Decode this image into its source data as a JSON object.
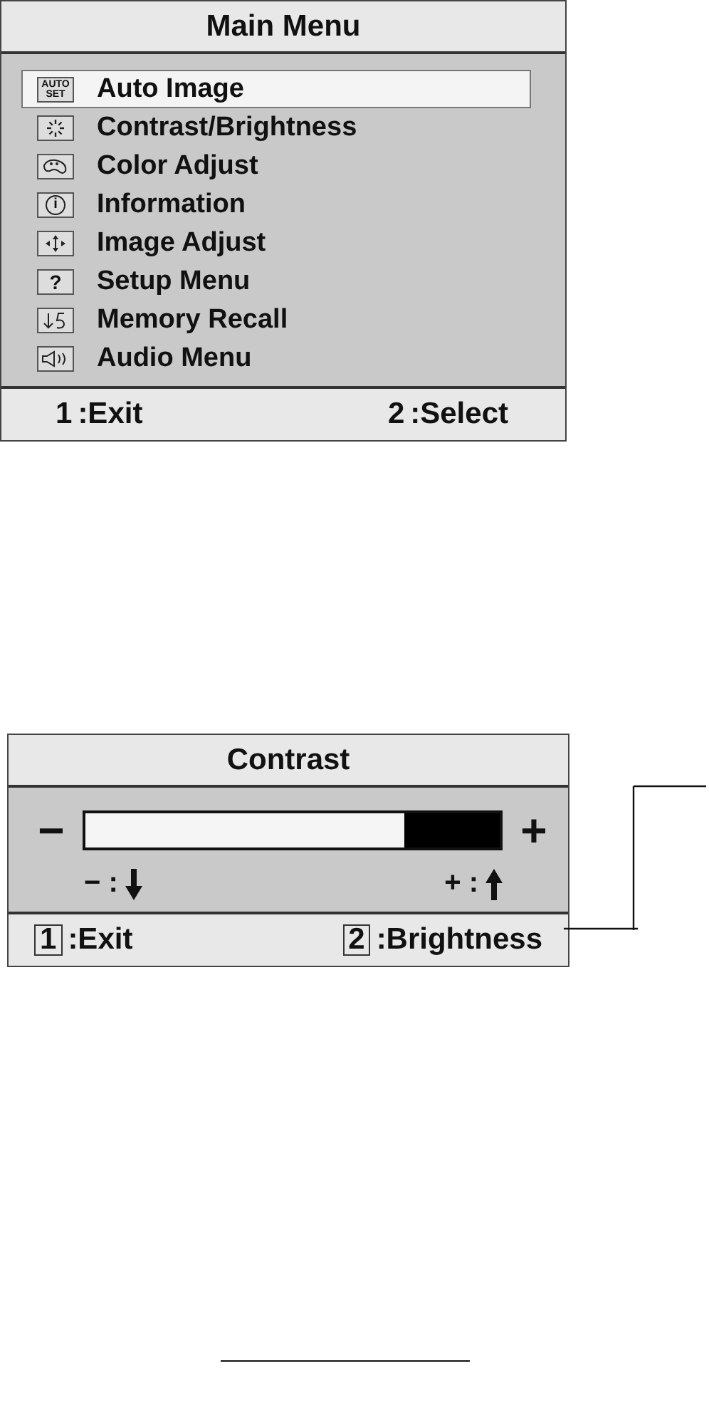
{
  "main_menu": {
    "title": "Main Menu",
    "items": [
      {
        "label": "Auto Image",
        "kind": "auto",
        "icon_label": "AUTO SET",
        "selected": true
      },
      {
        "label": "Contrast/Brightness",
        "kind": "sun",
        "selected": false
      },
      {
        "label": "Color Adjust",
        "kind": "palette",
        "selected": false
      },
      {
        "label": "Information",
        "kind": "info",
        "icon_label": "i",
        "selected": false
      },
      {
        "label": "Image Adjust",
        "kind": "move",
        "selected": false
      },
      {
        "label": "Setup Menu",
        "kind": "help",
        "icon_label": "?",
        "selected": false
      },
      {
        "label": "Memory Recall",
        "kind": "recall",
        "selected": false
      },
      {
        "label": "Audio Menu",
        "kind": "audio",
        "selected": false
      }
    ],
    "footer": [
      {
        "key": "1",
        "label": ":Exit",
        "boxed": false
      },
      {
        "key": "2",
        "label": ":Select",
        "boxed": false
      }
    ]
  },
  "contrast": {
    "title": "Contrast",
    "minus": "−",
    "plus": "+",
    "level": 0.77,
    "hints": [
      {
        "sign": "−",
        "sep": ":",
        "kind": "down"
      },
      {
        "sign": "+",
        "sep": ":",
        "kind": "up"
      }
    ],
    "footer": [
      {
        "key": "1",
        "label": ":Exit",
        "boxed": true
      },
      {
        "key": "2",
        "label": ":Brightness",
        "boxed": true
      }
    ]
  }
}
